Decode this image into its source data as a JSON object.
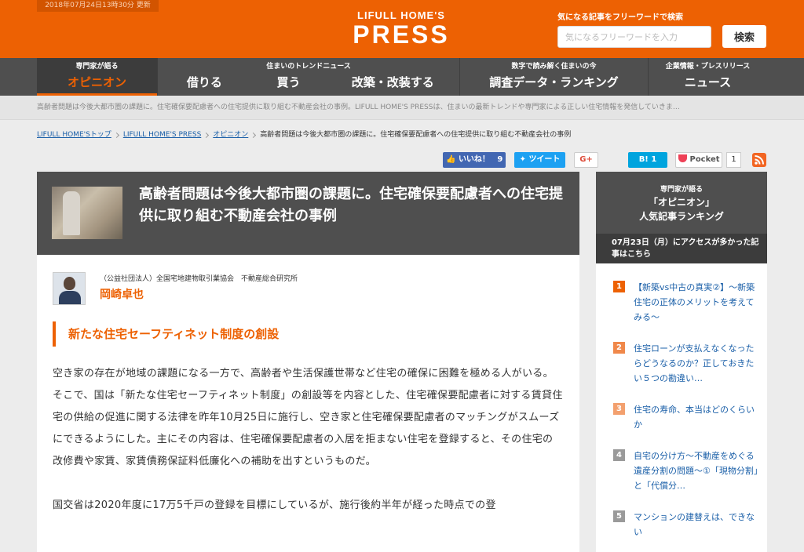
{
  "header": {
    "updated": "2018年07月24日13時30分 更新",
    "logo_top": "LIFULL HOME'S",
    "logo_main": "PRESS",
    "search_label": "気になる記事をフリーワードで検索",
    "search_placeholder": "気になるフリーワードを入力",
    "search_button": "検索",
    "brand_color": "#ed6103"
  },
  "nav": {
    "opinion": {
      "sub": "専門家が語る",
      "label": "オピニオン"
    },
    "trend_sub": "住まいのトレンドニュース",
    "rent": "借りる",
    "buy": "買う",
    "reform": "改築・改装する",
    "data": {
      "sub": "数字で読み解く住まいの今",
      "label": "調査データ・ランキング"
    },
    "news": {
      "sub": "企業情報・プレスリリース",
      "label": "ニュース"
    }
  },
  "ticker": "高齢者問題は今後大都市圏の課題に。住宅確保要配慮者への住宅提供に取り組む不動産会社の事例。LIFULL HOME'S PRESSは、住まいの最新トレンドや専門家による正しい住宅情報を発信していきま…",
  "breadcrumb": {
    "items": [
      "LIFULL HOME'Sトップ",
      "LIFULL HOME'S PRESS",
      "オピニオン"
    ],
    "current": "高齢者問題は今後大都市圏の課題に。住宅確保要配慮者への住宅提供に取り組む不動産会社の事例"
  },
  "share": {
    "like": "いいね！",
    "like_count": "9",
    "tweet": "ツイート",
    "gplus": "G+",
    "hatena": "B! 1",
    "pocket": "Pocket",
    "pocket_count": "1"
  },
  "article": {
    "title": "高齢者問題は今後大都市圏の課題に。住宅確保要配慮者への住宅提供に取り組む不動産会社の事例",
    "author_org": "（公益社団法人）全国宅地建物取引業協会　不動産総合研究所",
    "author_name": "岡崎卓也",
    "section_heading": "新たな住宅セーフティネット制度の創設",
    "paragraphs": [
      "空き家の存在が地域の課題になる一方で、高齢者や生活保護世帯など住宅の確保に困難を極める人がいる。",
      "そこで、国は「新たな住宅セーフティネット制度」の創設等を内容とした、住宅確保要配慮者に対する賃貸住宅の供給の促進に関する法律を昨年10月25日に施行し、空き家と住宅確保要配慮者のマッチングがスムーズにできるようにした。主にその内容は、住宅確保要配慮者の入居を拒まない住宅を登録すると、その住宅の改修費や家賃、家賃債務保証料低廉化への補助を出すというものだ。",
      "国交省は2020年度に17万5千戸の登録を目標にしているが、施行後約半年が経った時点での登"
    ]
  },
  "sidebar": {
    "sub": "専門家が語る",
    "title_line1": "「オピニオン」",
    "title_line2": "人気記事ランキング",
    "date_note": "07月23日（月）にアクセスが多かった記事はこちら",
    "ranking": [
      {
        "num": "1",
        "text": "【新築vs中古の真実②】〜新築住宅の正体のメリットを考えてみる〜",
        "color": "#ed6103"
      },
      {
        "num": "2",
        "text": "住宅ローンが支払えなくなったらどうなるのか？正しておきたい５つの勘違い…",
        "color": "#f0884a"
      },
      {
        "num": "3",
        "text": "住宅の寿命、本当はどのくらいか",
        "color": "#f3a06e"
      },
      {
        "num": "4",
        "text": "自宅の分け方〜不動産をめぐる遺産分割の問題〜①「現物分割」と「代償分…",
        "color": "#9a9a9a"
      },
      {
        "num": "5",
        "text": "マンションの建替えは、できない",
        "color": "#9a9a9a"
      }
    ]
  }
}
